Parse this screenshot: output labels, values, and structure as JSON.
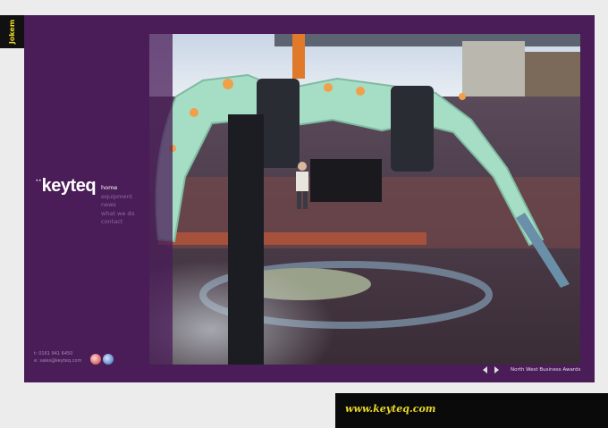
{
  "corner_logo": {
    "text": "Jokem"
  },
  "brand": {
    "dots": "··",
    "name": "keyteq"
  },
  "nav": {
    "items": [
      {
        "label": "home",
        "active": true
      },
      {
        "label": "equipment",
        "active": false
      },
      {
        "label": "news",
        "active": false
      },
      {
        "label": "what we do",
        "active": false
      },
      {
        "label": "contact",
        "active": false
      }
    ]
  },
  "contact": {
    "phone": "t: 0161 941 6450",
    "email": "e: sales@keyteq.com"
  },
  "badges": [
    "badge-red",
    "badge-blue"
  ],
  "slideshow": {
    "caption": "North West Business Awards",
    "prev_icon": "arrow-left-icon",
    "next_icon": "arrow-right-icon"
  },
  "footer": {
    "url": "www.keyteq.com"
  },
  "colors": {
    "frame": "#4a1c58",
    "page_bg": "#ececec",
    "url_text": "#e8d82a",
    "claw": "#a6ddc5"
  }
}
